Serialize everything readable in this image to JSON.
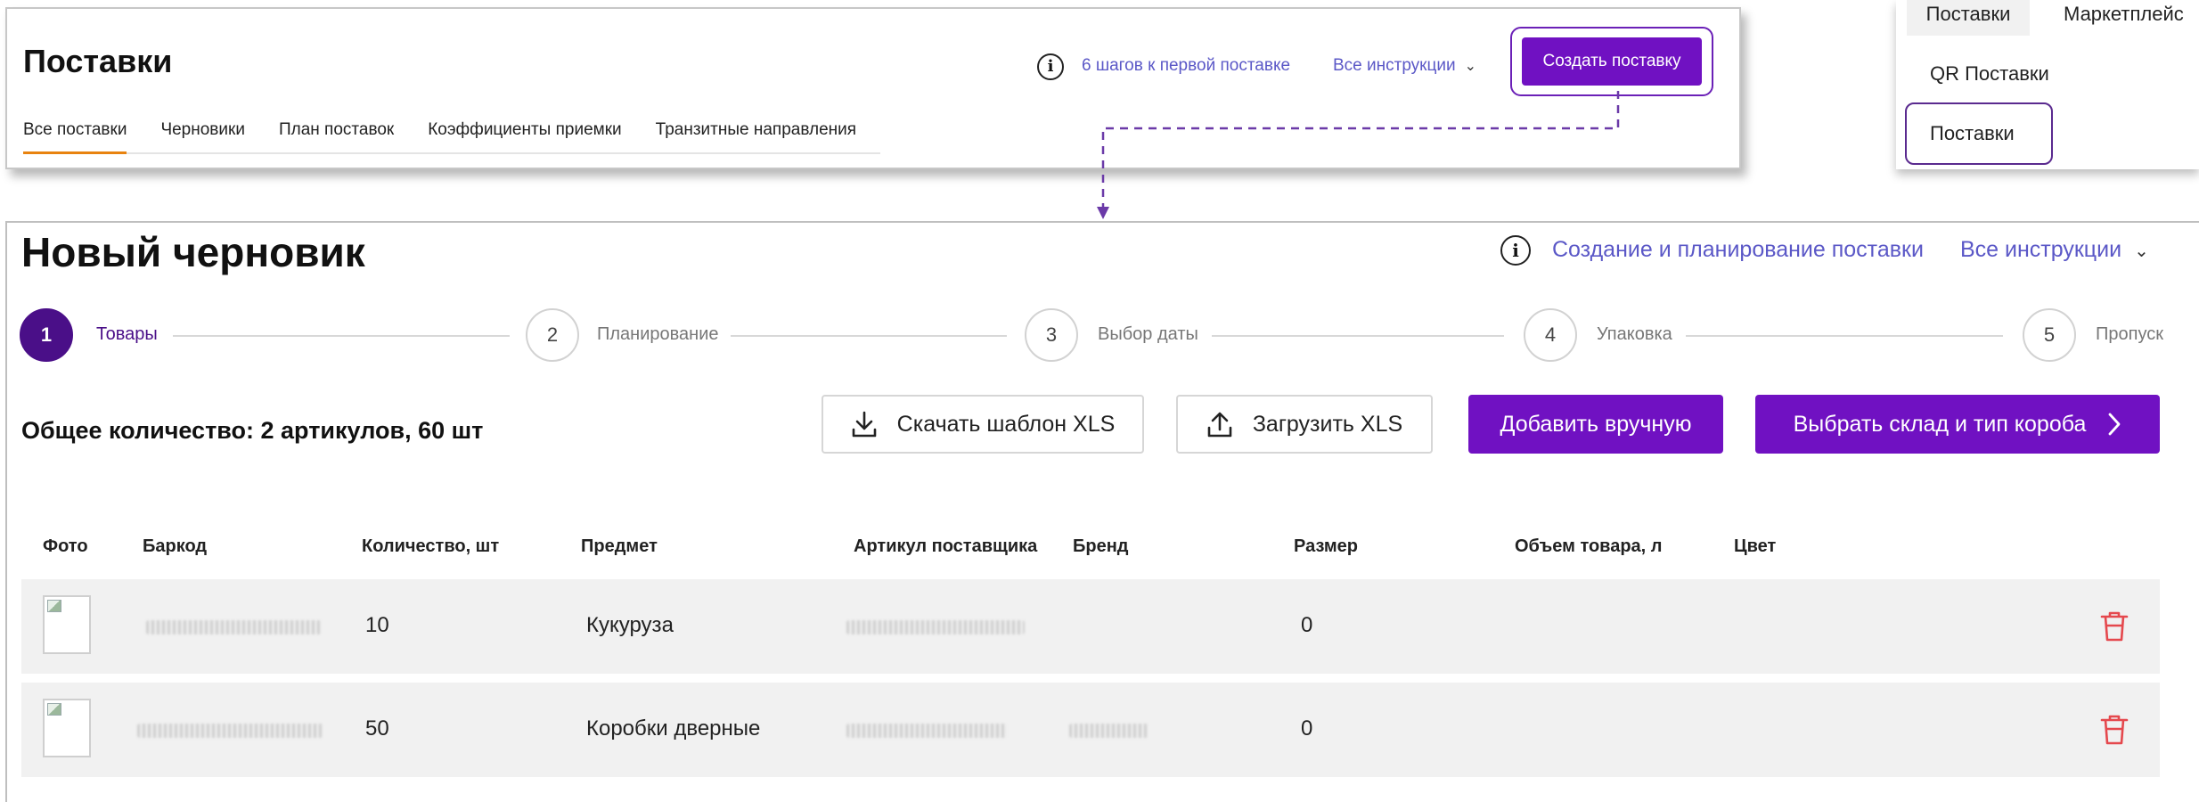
{
  "top": {
    "title": "Поставки",
    "tabs": [
      "Все поставки",
      "Черновики",
      "План поставок",
      "Коэффициенты приемки",
      "Транзитные направления"
    ],
    "info_icon": "i",
    "steps_link": "6 шагов к первой поставке",
    "instructions": "Все инструкции",
    "create_button": "Создать поставку",
    "accent": "#7011C2",
    "active_tab_color": "#E8830F"
  },
  "right_panel": {
    "tab_active": "Поставки",
    "tab_other": "Маркетплейс",
    "item_qr": "QR Поставки",
    "item_supplies": "Поставки"
  },
  "main": {
    "title": "Новый черновик",
    "info_icon": "i",
    "create_link": "Создание и планирование поставки",
    "instructions": "Все инструкции",
    "steps": [
      {
        "num": "1",
        "label": "Товары"
      },
      {
        "num": "2",
        "label": "Планирование"
      },
      {
        "num": "3",
        "label": "Выбор даты"
      },
      {
        "num": "4",
        "label": "Упаковка"
      },
      {
        "num": "5",
        "label": "Пропуск"
      }
    ],
    "active_step": 1,
    "total": "Общее количество: 2 артикулов, 60 шт",
    "buttons": {
      "download_xls": "Скачать шаблон XLS",
      "upload_xls": "Загрузить XLS",
      "add_manually": "Добавить вручную",
      "choose_warehouse": "Выбрать склад и тип короба"
    },
    "columns": [
      "Фото",
      "Баркод",
      "Количество, шт",
      "Предмет",
      "Артикул поставщика",
      "Бренд",
      "Размер",
      "Объем товара, л",
      "Цвет"
    ],
    "rows": [
      {
        "quantity": "10",
        "subject": "Кукуруза",
        "size": "0"
      },
      {
        "quantity": "50",
        "subject": "Коробки дверные",
        "size": "0"
      }
    ],
    "delete_color": "#E5484D"
  }
}
